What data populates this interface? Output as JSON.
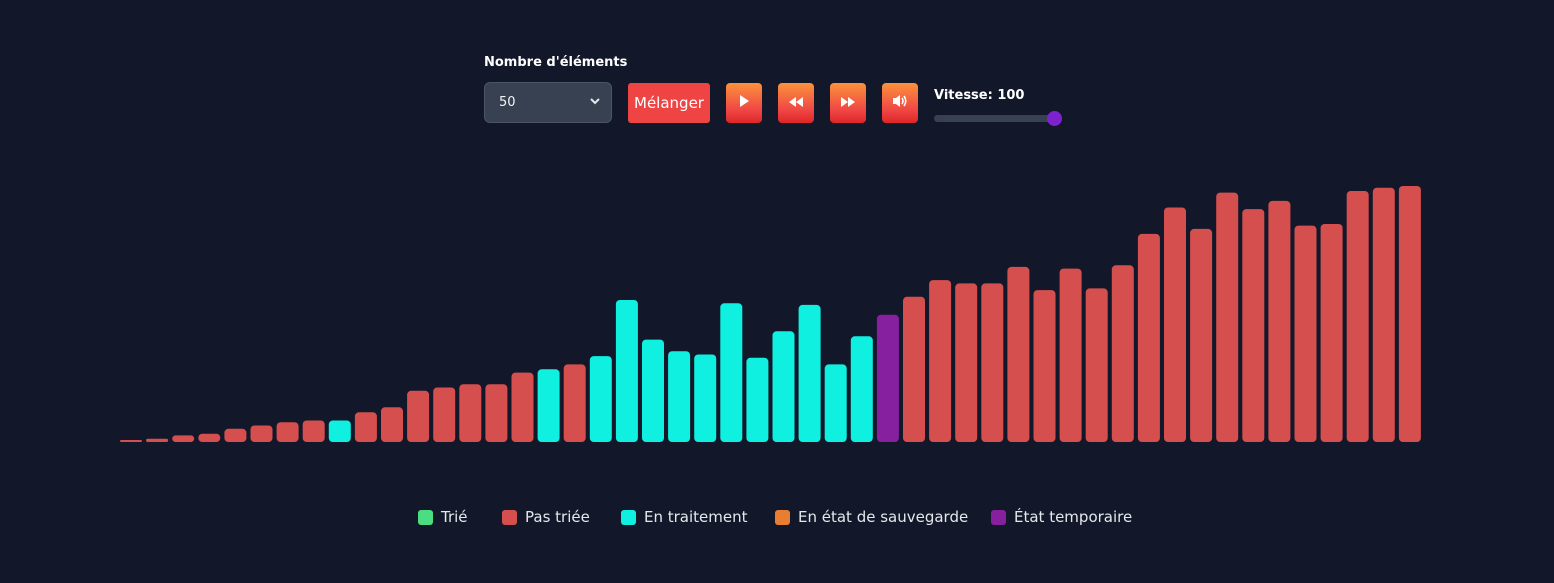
{
  "controls": {
    "count_label": "Nombre d'éléments",
    "count_value": "50",
    "shuffle_label": "Mélanger",
    "speed_label": "Vitesse: 100",
    "speed_fraction": 1.0
  },
  "icons": [
    "play-icon",
    "rewind-icon",
    "fast-forward-icon",
    "volume-icon"
  ],
  "colors": {
    "sorted": "#4ade80",
    "unsorted": "#d64f4f",
    "processing": "#0ff0e0",
    "saved": "#e97e32",
    "temporary": "#86209f",
    "button": "#ef4444",
    "background": "#121829"
  },
  "legend": [
    {
      "label": "Trié",
      "color": "#4ade80"
    },
    {
      "label": "Pas triée",
      "color": "#d64f4f"
    },
    {
      "label": "En traitement",
      "color": "#0ff0e0"
    },
    {
      "label": "En état de sauvegarde",
      "color": "#e97e32"
    },
    {
      "label": "État temporaire",
      "color": "#86209f"
    }
  ],
  "chart_data": {
    "type": "bar",
    "values": [
      1,
      2,
      4,
      5,
      8,
      10,
      12,
      13,
      13,
      18,
      21,
      31,
      33,
      35,
      35,
      42,
      44,
      47,
      52,
      86,
      62,
      55,
      53,
      84,
      51,
      67,
      83,
      47,
      64,
      77,
      88,
      98,
      96,
      96,
      106,
      92,
      105,
      93,
      107,
      126,
      142,
      129,
      151,
      141,
      146,
      131,
      132,
      152,
      154,
      155
    ],
    "states": [
      "unsorted",
      "unsorted",
      "unsorted",
      "unsorted",
      "unsorted",
      "unsorted",
      "unsorted",
      "unsorted",
      "processing",
      "unsorted",
      "unsorted",
      "unsorted",
      "unsorted",
      "unsorted",
      "unsorted",
      "unsorted",
      "processing",
      "unsorted",
      "processing",
      "processing",
      "processing",
      "processing",
      "processing",
      "processing",
      "processing",
      "processing",
      "processing",
      "processing",
      "processing",
      "temporary",
      "unsorted",
      "unsorted",
      "unsorted",
      "unsorted",
      "unsorted",
      "unsorted",
      "unsorted",
      "unsorted",
      "unsorted",
      "unsorted",
      "unsorted",
      "unsorted",
      "unsorted",
      "unsorted",
      "unsorted",
      "unsorted",
      "unsorted",
      "unsorted",
      "unsorted",
      "unsorted"
    ],
    "ylim": [
      0,
      155
    ]
  }
}
